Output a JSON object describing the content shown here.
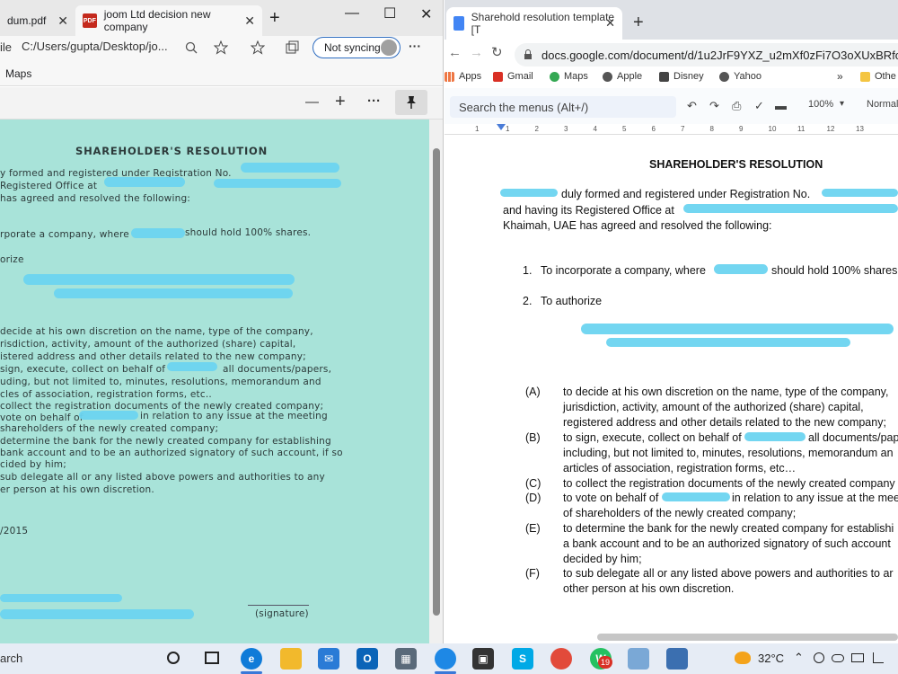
{
  "left_window": {
    "tabs": [
      {
        "label": "dum.pdf",
        "close": "✕"
      },
      {
        "label": "joom Ltd decision new company",
        "close": "✕"
      }
    ],
    "new_tab": "+",
    "window_controls": {
      "minimize": "—",
      "maximize": "☐",
      "close": "✕"
    },
    "address": {
      "prefix": "ile",
      "url": "C:/Users/gupta/Desktop/jo...",
      "not_syncing": "Not syncing",
      "menu": "···"
    },
    "favorites": {
      "maps": "Maps"
    },
    "pdf_toolbar": {
      "zoom_out": "—",
      "zoom_in": "+",
      "more": "···",
      "pin": "📌"
    },
    "scan": {
      "title": "SHAREHOLDER'S RESOLUTION",
      "lines": [
        "y formed and registered under Registration No.",
        "Registered Office at",
        "has agreed and resolved the following:",
        "rporate a company, where",
        "should hold 100% shares.",
        "orize",
        "decide at his own discretion on the name, type of the company,",
        "risdiction, activity, amount of the authorized (share) capital,",
        "istered address and other details related to the new company;",
        "sign, execute, collect on behalf of",
        "all documents/papers,",
        "uding, but not limited to, minutes, resolutions, memorandum and",
        "cles of association, registration forms, etc..",
        "collect the registration documents of the newly created company;",
        "vote on behalf of",
        "in relation to any issue at the meeting",
        "shareholders of the newly created company;",
        "determine the bank for the newly created company for establishing",
        "bank account and to be an authorized signatory of such account, if so",
        "cided by him;",
        "sub delegate all or any listed above powers and authorities to any",
        "er person at his own discretion."
      ],
      "date": "/2015",
      "signature": "(signature)"
    }
  },
  "right_window": {
    "tab": {
      "label": "Sharehold resolution template [T",
      "close": "✕"
    },
    "new_tab": "+",
    "url": "docs.google.com/document/d/1u2JrF9YXZ_u2mXf0zFi7O3oXUxBRfo...",
    "bookmarks": [
      "Apps",
      "Gmail",
      "Maps",
      "Apple",
      "Disney",
      "Yahoo"
    ],
    "bookmarks_more": "»",
    "bookmarks_other": "Othe",
    "docs_toolbar": {
      "search": "Search the menus (Alt+/)",
      "zoom": "100%",
      "style": "Normal"
    },
    "ruler": [
      "1",
      "1",
      "2",
      "3",
      "4",
      "5",
      "6",
      "7",
      "8",
      "9",
      "10",
      "11",
      "12",
      "13"
    ],
    "doc": {
      "title": "SHAREHOLDER'S RESOLUTION",
      "intro": [
        "duly formed and registered under Registration No.",
        "and  having its Registered Office at",
        "Khaimah, UAE has agreed and resolved the following:"
      ],
      "items": [
        {
          "num": "1.",
          "text": "To incorporate a company, where",
          "tail": "should hold 100% shares"
        },
        {
          "num": "2.",
          "text": "To authorize"
        }
      ],
      "clauses": [
        {
          "label": "(A)",
          "lines": [
            "to decide at his own discretion on the name, type of the company,",
            "jurisdiction, activity, amount of the authorized (share) capital,",
            "registered address and other details related to the new company;"
          ]
        },
        {
          "label": "(B)",
          "lines": [
            "to sign, execute, collect on behalf of",
            "including, but not limited to, minutes, resolutions, memorandum an",
            "articles of association, registration forms, etc…"
          ],
          "tail": "all documents/pap"
        },
        {
          "label": "(C)",
          "lines": [
            "to collect the registration documents of the newly created company"
          ]
        },
        {
          "label": "(D)",
          "lines": [
            "to vote on behalf of",
            "of shareholders of the newly created company;"
          ],
          "tail": "in relation to any issue at the meet"
        },
        {
          "label": "(E)",
          "lines": [
            "to determine the bank for the newly created company for establishi",
            "a bank account and to be an authorized signatory of such account",
            "decided by him;"
          ]
        },
        {
          "label": "(F)",
          "lines": [
            "to sub delegate all or any listed above powers and authorities to ar",
            "other person at his own discretion."
          ]
        }
      ]
    }
  },
  "taskbar": {
    "search": "arch",
    "temperature": "32°C",
    "notification_badge": "19"
  }
}
